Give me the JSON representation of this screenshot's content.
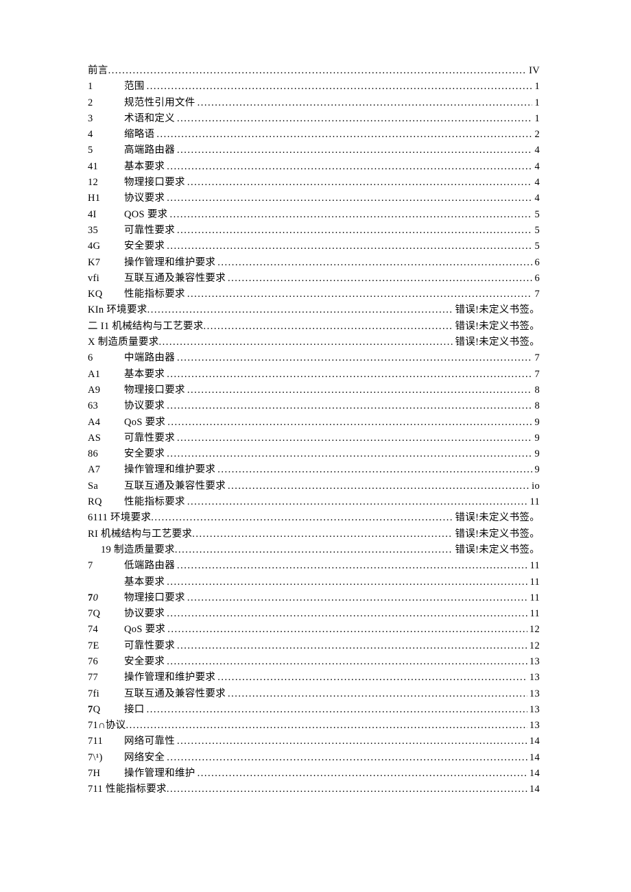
{
  "toc": [
    {
      "num": "前言",
      "title": "",
      "page": "IV",
      "wide": true
    },
    {
      "num": "1",
      "title": "范围",
      "page": "1"
    },
    {
      "num": "2",
      "title": "规范性引用文件",
      "page": "1"
    },
    {
      "num": "3",
      "title": "术语和定义",
      "page": "1"
    },
    {
      "num": "4",
      "title": "缩略语",
      "page": "2"
    },
    {
      "num": "5",
      "title": "高端路由器",
      "page": "4"
    },
    {
      "num": "41",
      "title": "基本要求",
      "page": "4"
    },
    {
      "num": "12",
      "title": "物理接口要求",
      "page": "4"
    },
    {
      "num": "H1",
      "title": "协议要求",
      "page": "4"
    },
    {
      "num": "4I",
      "title": "QOS 要求",
      "page": "5"
    },
    {
      "num": "35",
      "title": "可靠性要求",
      "page": "5"
    },
    {
      "num": "4G",
      "title": "安全要求",
      "page": "5"
    },
    {
      "num": "K7",
      "title": "操作管理和维护要求",
      "page": "6"
    },
    {
      "num": "vfi",
      "title": "互联互通及兼容性要求",
      "page": "6"
    },
    {
      "num": "KQ",
      "title": "性能指标要求",
      "page": "7"
    },
    {
      "num": "KIn 环境要求",
      "title": "",
      "page": "错误!未定义书签。",
      "wide": true
    },
    {
      "num": "二 I1 机械结构与工艺要求",
      "title": "",
      "page": "错误!未定义书签。",
      "wide": true
    },
    {
      "num": "X 制造质量要求",
      "title": "",
      "page": "错误!未定义书签。",
      "wide": true
    },
    {
      "num": "6",
      "title": "中端路由器",
      "page": "7"
    },
    {
      "num": "A1",
      "title": "基本要求",
      "page": "7"
    },
    {
      "num": "A9",
      "title": "物理接口要求",
      "page": "8"
    },
    {
      "num": "63",
      "title": "协议要求",
      "page": "8"
    },
    {
      "num": "A4",
      "title": "QoS 要求",
      "page": "9"
    },
    {
      "num": "AS",
      "title": "可靠性要求",
      "page": "9"
    },
    {
      "num": "86",
      "title": "安全要求",
      "page": "9"
    },
    {
      "num": "A7",
      "title": "操作管理和维护要求",
      "page": "9"
    },
    {
      "num": "Sa",
      "title": "互联互通及兼容性要求",
      "page": "io"
    },
    {
      "num": "RQ",
      "title": "性能指标要求",
      "page": "11"
    },
    {
      "num": "6111 环境要求",
      "title": "",
      "page": "错误!未定义书签。",
      "wide": true
    },
    {
      "num": "RI 机械结构与工艺要求",
      "title": "",
      "page": "错误!未定义书签。",
      "wide": true
    },
    {
      "num": "19 制造质量要求",
      "title": "",
      "page": "错误!未定义书签。",
      "wide": true,
      "indent": true
    },
    {
      "num": "7",
      "title": "低端路由器",
      "page": "11"
    },
    {
      "num": "",
      "title": "基本要求",
      "page": "11"
    },
    {
      "num": "70",
      "title": "物理接口要求",
      "page": "11",
      "bold0": true,
      "ital1": true
    },
    {
      "num": "7Q",
      "title": "协议要求",
      "page": "11"
    },
    {
      "num": "74",
      "title": "QoS 要求",
      "page": "12"
    },
    {
      "num": "7E",
      "title": "可靠性要求",
      "page": "12"
    },
    {
      "num": "76",
      "title": "安全要求",
      "page": "13"
    },
    {
      "num": "77",
      "title": "操作管理和维护要求",
      "page": "13"
    },
    {
      "num": "7fi",
      "title": "互联互通及兼容性要求",
      "page": "13"
    },
    {
      "num": "7Q",
      "title": "接口",
      "page": "13",
      "bold0": true
    },
    {
      "num": "71∩协议",
      "title": "",
      "page": "13",
      "wide": true
    },
    {
      "num": "711",
      "title": "网络可靠性",
      "page": "14"
    },
    {
      "num": "7\\¹)",
      "title": "网络安全",
      "page": "14",
      "supafter": true
    },
    {
      "num": "7H",
      "title": "操作管理和维护",
      "page": "14"
    },
    {
      "num": "711 性能指标要求",
      "title": "",
      "page": "14",
      "wide": true
    }
  ]
}
